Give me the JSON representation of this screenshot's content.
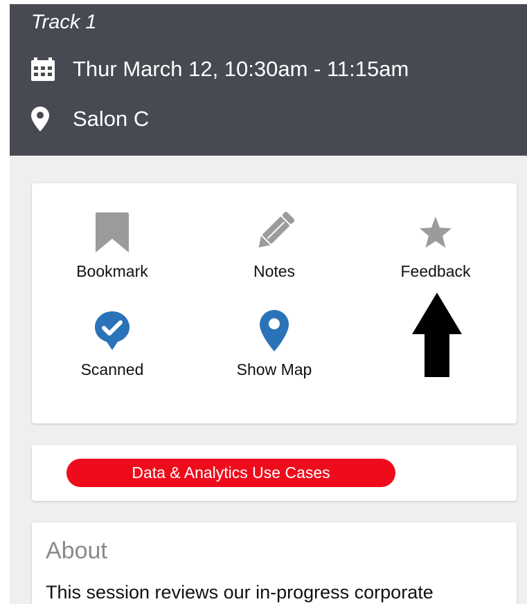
{
  "session": {
    "track": "Track 1",
    "datetime": "Thur March 12, 10:30am - 11:15am",
    "location": "Salon C"
  },
  "actions": {
    "bookmark": "Bookmark",
    "notes": "Notes",
    "feedback": "Feedback",
    "scanned": "Scanned",
    "show_map": "Show Map"
  },
  "tags": {
    "primary": "Data & Analytics Use Cases"
  },
  "about": {
    "title": "About",
    "text": "This session reviews our in-progress corporate"
  },
  "icons": {
    "calendar": "calendar-icon",
    "location": "location-pin-icon",
    "bookmark": "bookmark-icon",
    "notes": "pencil-icon",
    "feedback": "star-icon",
    "scanned": "check-badge-icon",
    "show_map": "map-pin-icon",
    "annotation": "up-arrow-icon"
  },
  "colors": {
    "header_bg": "#474a52",
    "page_bg": "#efefef",
    "icon_gray": "#9b9b9b",
    "icon_blue": "#2a73b8",
    "tag_red": "#ee0c1c"
  }
}
